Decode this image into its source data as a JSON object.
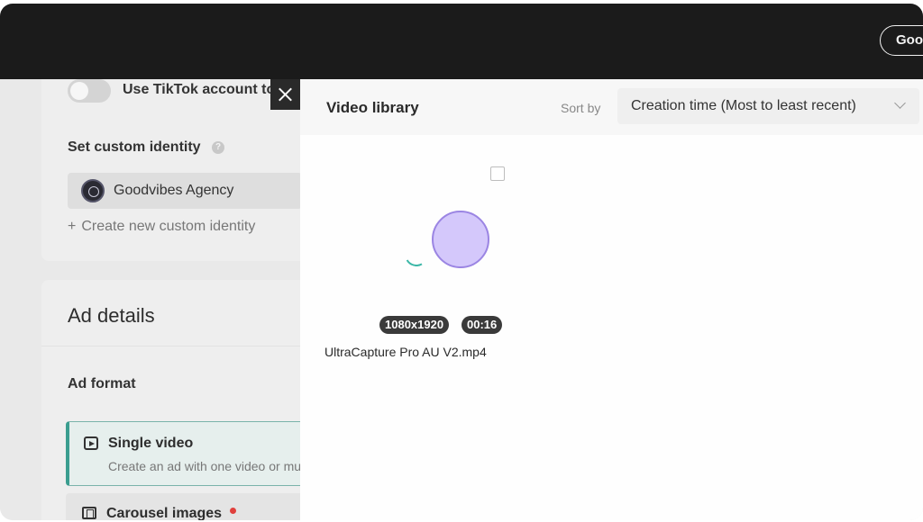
{
  "topbar": {
    "account_label": "Goodvibes Agency"
  },
  "identity": {
    "toggle_label": "Use TikTok account to deliver Spark Ads",
    "custom_identity_title": "Set custom identity",
    "help_icon": "?",
    "selected_identity": "Goodvibes Agency",
    "create_new": "Create new custom identity",
    "plus_icon": "+"
  },
  "ad_details": {
    "title": "Ad details",
    "format_title": "Ad format",
    "options": [
      {
        "label": "Single video",
        "description": "Create an ad with one video or multiple images",
        "selected": true
      },
      {
        "label": "Carousel images",
        "badge": "new",
        "selected": false
      }
    ]
  },
  "drawer": {
    "title": "Video library",
    "sort_label": "Sort by",
    "sort_value": "Creation time (Most to least recent)",
    "videos": [
      {
        "resolution": "1080x1920",
        "duration": "00:16",
        "filename": "UltraCapture Pro AU V2.mp4",
        "checked": false,
        "loading": true
      }
    ]
  },
  "colors": {
    "topbar": "#1b1b1b",
    "accent": "#3a9d8f",
    "badge_red": "#e0403d",
    "cursor": "#cdbefa"
  }
}
